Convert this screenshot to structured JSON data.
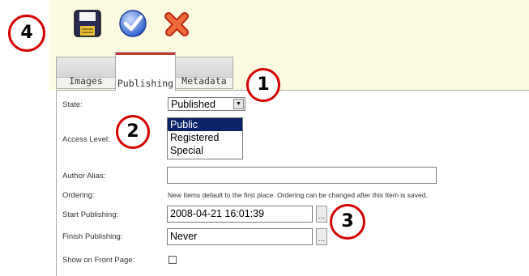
{
  "toolbar": {
    "save_icon": "floppy-disk-icon",
    "apply_icon": "blue-checkmark-icon",
    "cancel_icon": "red-x-icon"
  },
  "tabs": [
    {
      "label": "Images",
      "active": false
    },
    {
      "label": "Publishing",
      "active": true
    },
    {
      "label": "Metadata",
      "active": false
    }
  ],
  "form": {
    "state_label": "State:",
    "state_value": "Published",
    "access_label": "Access Level:",
    "access_options": [
      "Public",
      "Registered",
      "Special"
    ],
    "access_selected": "Public",
    "author_alias_label": "Author Alias:",
    "author_alias_value": "",
    "ordering_label": "Ordering:",
    "ordering_hint": "New Items default to the first place. Ordering can be changed after this Item is saved.",
    "start_label": "Start Publishing:",
    "start_value": "2008-04-21 16:01:39",
    "finish_label": "Finish Publishing:",
    "finish_value": "Never",
    "calendar_button": "...",
    "frontpage_label": "Show on Front Page:",
    "frontpage_checked": false
  },
  "callouts": [
    "1",
    "2",
    "3",
    "4"
  ],
  "colors": {
    "callout_ring": "#d40000",
    "toolbar_bg": "#fcfbe2",
    "selected_option": "#0a246a"
  }
}
